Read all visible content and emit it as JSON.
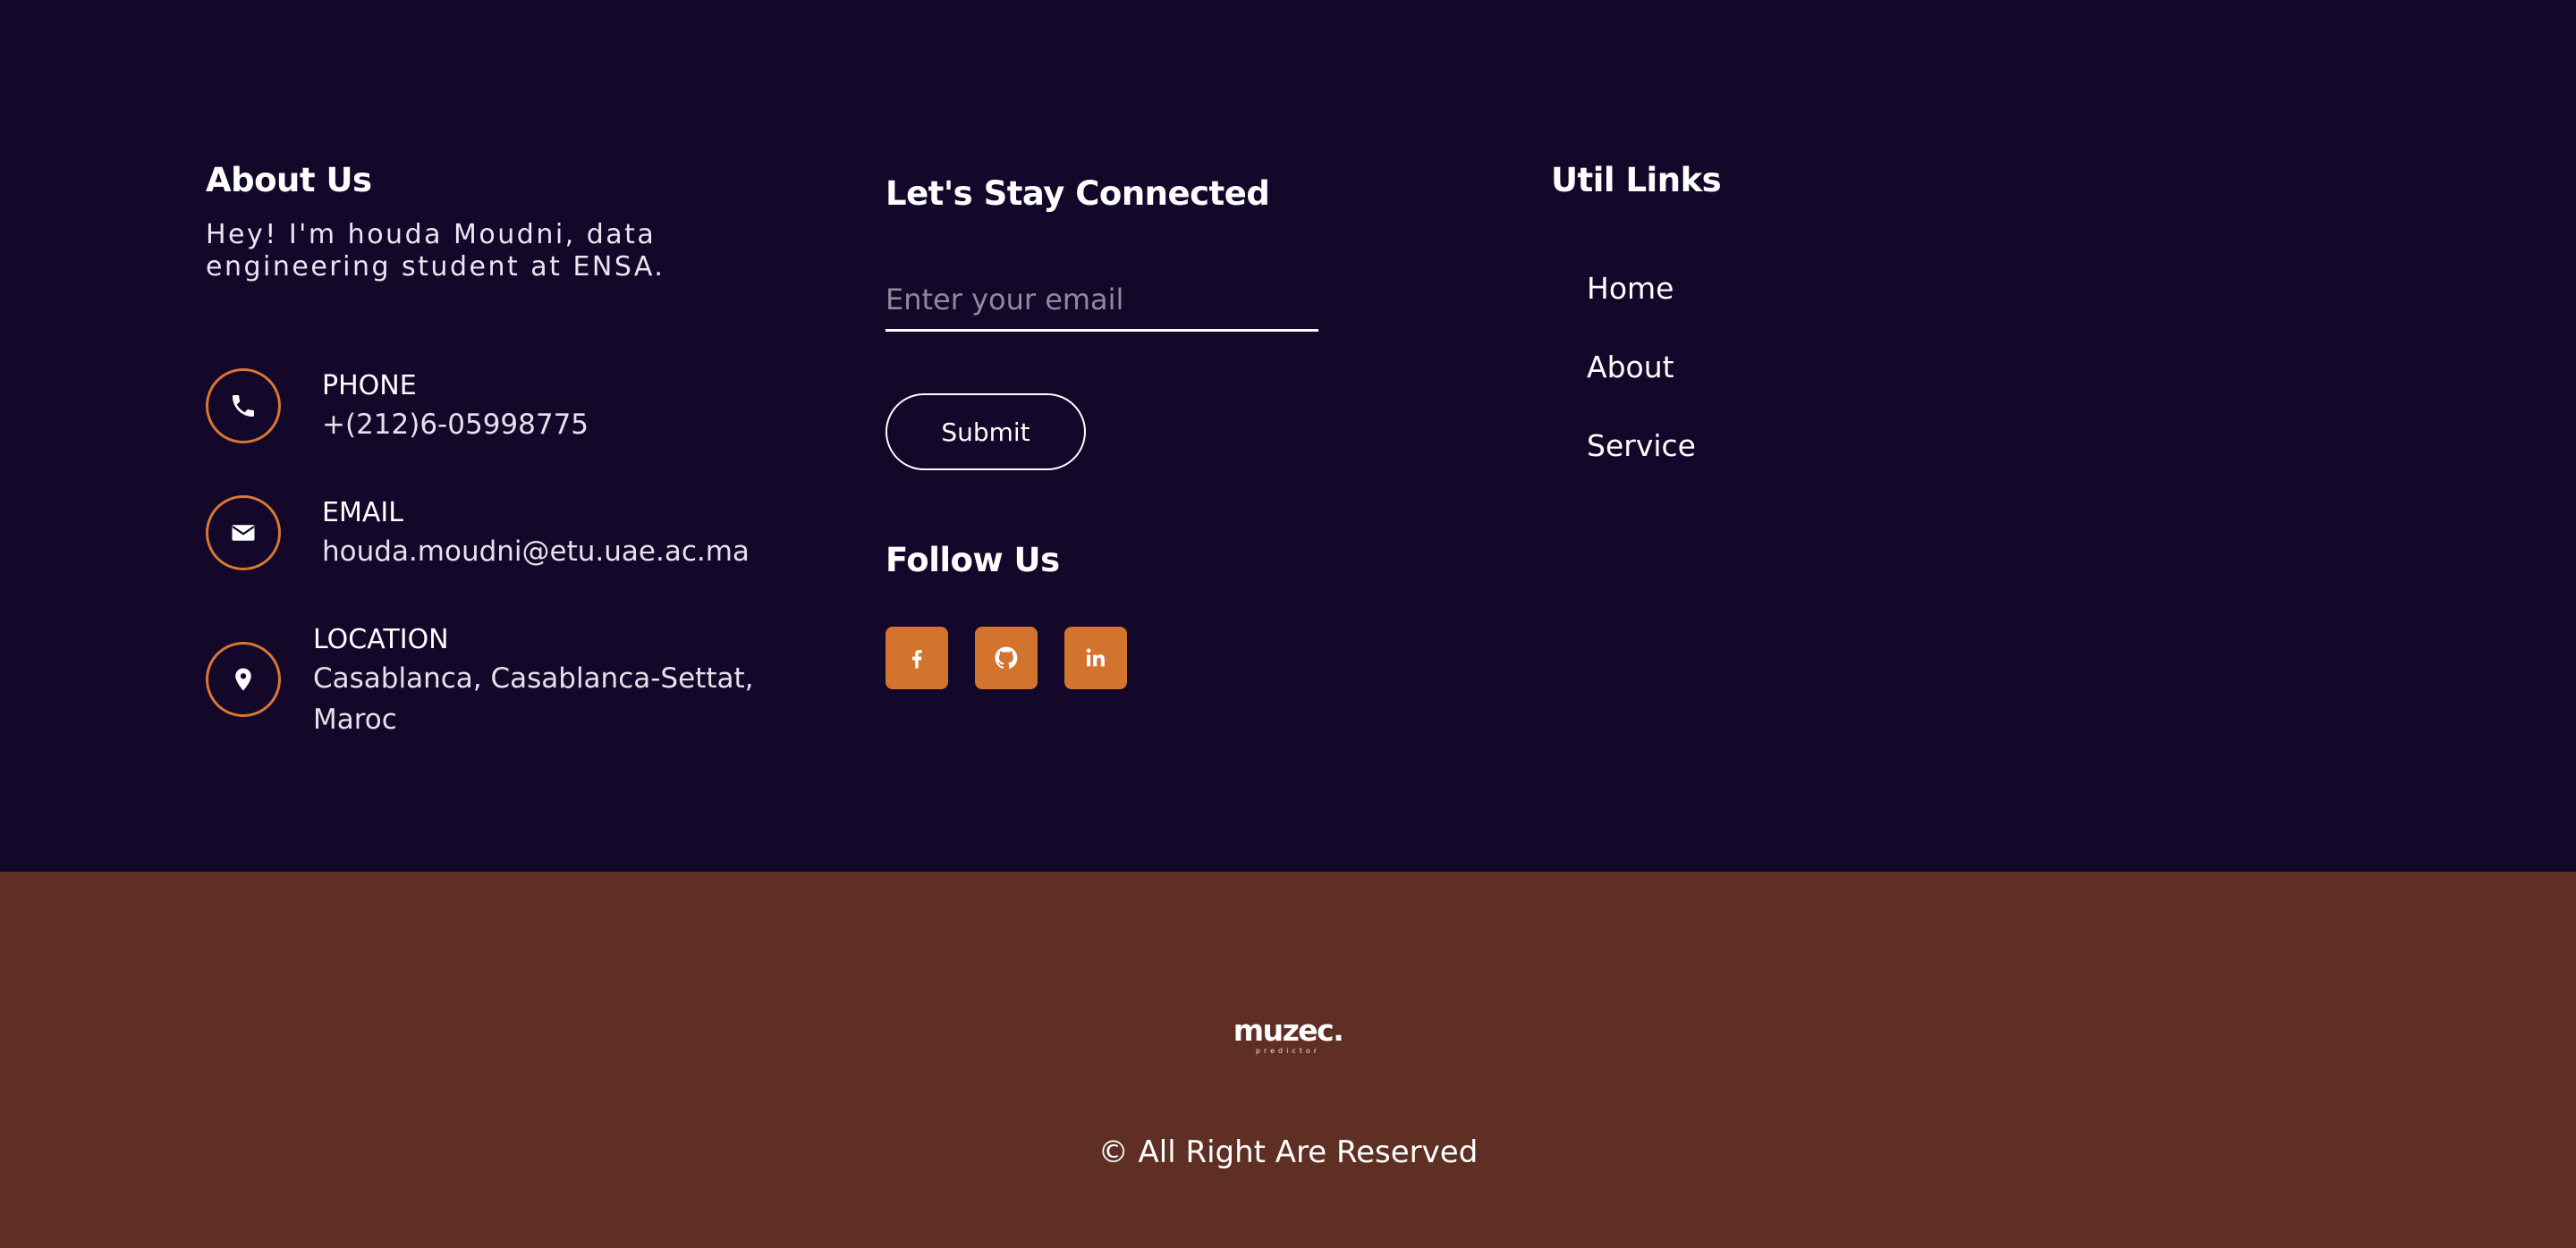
{
  "about": {
    "title": "About Us",
    "text": "Hey! I'm houda Moudni, data engineering student at ENSA.",
    "contacts": [
      {
        "title": "PHONE",
        "value": "+(212)6-05998775",
        "icon": "phone-icon"
      },
      {
        "title": "EMAIL",
        "value": "houda.moudni@etu.uae.ac.ma",
        "icon": "envelope-icon"
      },
      {
        "title": "LOCATION",
        "value_line1": "Casablanca, Casablanca-Settat,",
        "value_line2": "Maroc",
        "icon": "map-pin-icon"
      }
    ]
  },
  "connect": {
    "title": "Let's Stay Connected",
    "email_placeholder": "Enter your email",
    "email_value": "",
    "submit_label": "Submit",
    "follow_title": "Follow Us",
    "socials": [
      "facebook-icon",
      "github-icon",
      "linkedin-icon"
    ]
  },
  "links": {
    "title": "Util Links",
    "items": [
      "Home",
      "About",
      "Service"
    ]
  },
  "footer": {
    "logo_main": "muzec.",
    "logo_sub": "predictor",
    "copyright": "© All Right Are Reserved"
  },
  "colors": {
    "top_background": "#13072a",
    "bottom_background": "#5e2f22",
    "accent": "#d97634"
  }
}
